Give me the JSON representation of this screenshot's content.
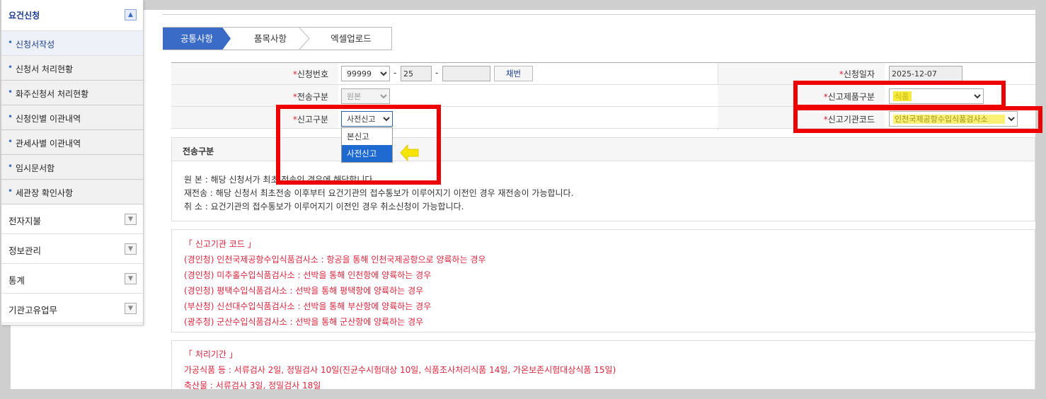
{
  "sidebar": {
    "header": "요건신청",
    "sub_items": [
      {
        "label": "신청서작성"
      },
      {
        "label": "신청서 처리현황"
      },
      {
        "label": "화주신청서 처리현황"
      },
      {
        "label": "신청인별 이관내역"
      },
      {
        "label": "관세사별 이관내역"
      },
      {
        "label": "임시문서함"
      },
      {
        "label": "세관장 확인사항"
      }
    ],
    "main_items": [
      {
        "label": "전자지불"
      },
      {
        "label": "정보관리"
      },
      {
        "label": "통계"
      },
      {
        "label": "기관고유업무"
      }
    ]
  },
  "tabs": [
    {
      "label": "공통사항"
    },
    {
      "label": "품목사항"
    },
    {
      "label": "엑셀업로드"
    }
  ],
  "form": {
    "required_mark": "*",
    "app_no_label": "신청번호",
    "app_no_select": "99999",
    "app_no_mid": "25",
    "app_no_sep": "-",
    "app_no_last": "",
    "issue_button": "채번",
    "app_date_label": "신청일자",
    "app_date_value": "2025-12-07",
    "send_type_label": "전송구분",
    "send_type_value": "원본",
    "product_type_label": "신고제품구분",
    "product_type_value": "식품",
    "report_type_label": "신고구분",
    "report_type_value": "사전신고",
    "agency_code_label": "신고기관코드",
    "agency_code_value": "인천국제공항수입식품검사소"
  },
  "dropdown": {
    "options": [
      {
        "label": "본신고"
      },
      {
        "label": "사전신고"
      }
    ]
  },
  "info_send": {
    "title": "전송구분",
    "lines": [
      "원  본 : 해당 신청서가 최초 전송인 경우에 해당합니다.",
      "재전송 : 해당 신청서 최초전송 이후부터 요건기관의 접수통보가 이루어지기 이전인 경우 재전송이 가능합니다.",
      "취  소 : 요건기관의 접수통보가 이루어지기 이전인 경우 취소신청이 가능합니다."
    ]
  },
  "info_agency": {
    "title": "「 신고기관 코드 」",
    "lines": [
      "(경인청) 인천국제공항수입식품검사소 : 항공을 통해 인천국제공항으로 양륙하는 경우",
      "(경인청) 미추홀수입식품검사소 : 선박을 통해 인천항에 양륙하는 경우",
      "(경인청) 평택수입식품검사소 : 선박을 통해 평택항에 양륙하는 경우",
      "(부산청) 신선대수입식품검사소 : 선박을 통해 부산항에 양륙하는 경우",
      "(광주청) 군산수입식품검사소 : 선박을 통해 군산항에 양륙하는 경우"
    ]
  },
  "info_period": {
    "title": "「 처리기간 」",
    "lines": [
      "가공식품 등 : 서류검사 2일, 정밀검사 10일(진균수시험대상 10일, 식품조사처리식품 14일, 가온보존시험대상식품 15일)",
      "축산물 : 서류검사 3일, 정밀검사 18일"
    ]
  },
  "colors": {
    "accent": "#3a6bc7",
    "highlight_box": "#ee0000",
    "notice_text": "#d7263d",
    "marker": "#f5e400"
  }
}
